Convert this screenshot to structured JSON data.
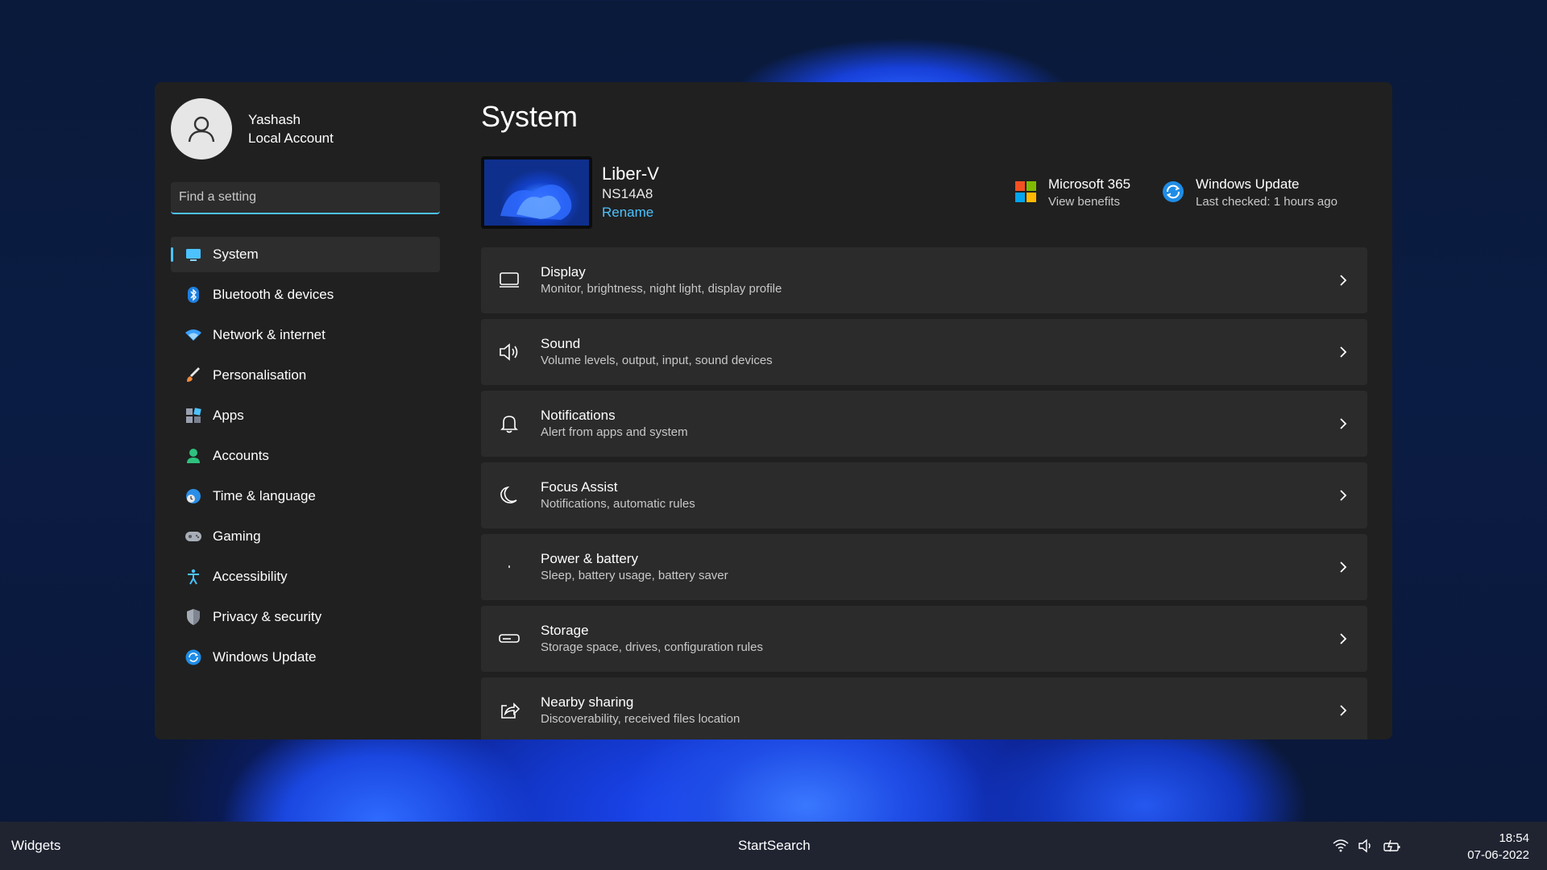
{
  "user": {
    "name": "Yashash",
    "account_type": "Local Account"
  },
  "search": {
    "placeholder": "Find a setting"
  },
  "sidebar": {
    "items": [
      {
        "label": "System",
        "icon": "monitor-icon",
        "active": true
      },
      {
        "label": "Bluetooth & devices",
        "icon": "bluetooth-icon"
      },
      {
        "label": "Network & internet",
        "icon": "wifi-icon"
      },
      {
        "label": "Personalisation",
        "icon": "brush-icon"
      },
      {
        "label": "Apps",
        "icon": "apps-icon"
      },
      {
        "label": "Accounts",
        "icon": "person-icon"
      },
      {
        "label": "Time & language",
        "icon": "globe-clock-icon"
      },
      {
        "label": "Gaming",
        "icon": "gamepad-icon"
      },
      {
        "label": "Accessibility",
        "icon": "accessibility-icon"
      },
      {
        "label": "Privacy & security",
        "icon": "shield-icon"
      },
      {
        "label": "Windows Update",
        "icon": "update-icon"
      }
    ]
  },
  "main": {
    "title": "System",
    "device": {
      "name": "Liber-V",
      "model": "NS14A8",
      "rename_label": "Rename"
    },
    "quick_links": {
      "microsoft365": {
        "title": "Microsoft 365",
        "subtitle": "View benefits",
        "icon": "microsoft-logo-icon"
      },
      "windows_update": {
        "title": "Windows Update",
        "subtitle": "Last checked: 1 hours ago",
        "icon": "update-icon"
      }
    },
    "cards": [
      {
        "title": "Display",
        "subtitle": "Monitor, brightness, night light, display profile",
        "icon": "display-icon"
      },
      {
        "title": "Sound",
        "subtitle": "Volume levels, output, input, sound devices",
        "icon": "speaker-icon"
      },
      {
        "title": "Notifications",
        "subtitle": "Alert from apps and system",
        "icon": "bell-icon"
      },
      {
        "title": "Focus Assist",
        "subtitle": "Notifications, automatic rules",
        "icon": "moon-icon"
      },
      {
        "title": "Power & battery",
        "subtitle": "Sleep, battery usage, battery saver",
        "icon": "power-icon"
      },
      {
        "title": "Storage",
        "subtitle": "Storage space, drives, configuration rules",
        "icon": "storage-icon"
      },
      {
        "title": "Nearby sharing",
        "subtitle": "Discoverability, received files location",
        "icon": "share-icon"
      }
    ]
  },
  "taskbar": {
    "widgets_label": "Widgets",
    "start_label": "StartSearch",
    "time": "18:54",
    "date": "07-06-2022",
    "tray_icons": [
      "wifi-icon",
      "volume-icon",
      "battery-charging-icon"
    ]
  },
  "colors": {
    "accent": "#4cc2ff",
    "window_bg": "#202020",
    "card_bg": "#2b2b2b"
  }
}
